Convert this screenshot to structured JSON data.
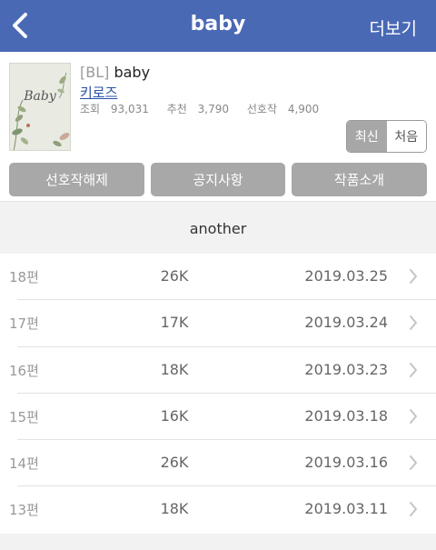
{
  "nav": {
    "back_icon": "chevron-left-icon",
    "title": "baby",
    "more_label": "더보기"
  },
  "book": {
    "cover_title": "Baby",
    "cover_subtitle": "",
    "genre": "[BL]",
    "title": "baby",
    "author": "키로즈",
    "stats": [
      {
        "label": "조회",
        "value": "93,031"
      },
      {
        "label": "추천",
        "value": "3,790"
      },
      {
        "label": "선호작",
        "value": "4,900"
      }
    ]
  },
  "sort": {
    "latest_label": "최신",
    "first_label": "처음",
    "active": "latest"
  },
  "actions": {
    "unfavorite_label": "선호작해제",
    "notice_label": "공지사항",
    "intro_label": "작품소개"
  },
  "section": {
    "title": "another"
  },
  "episodes": [
    {
      "ep": "18편",
      "size": "26K",
      "date": "2019.03.25"
    },
    {
      "ep": "17편",
      "size": "17K",
      "date": "2019.03.24"
    },
    {
      "ep": "16편",
      "size": "18K",
      "date": "2019.03.23"
    },
    {
      "ep": "15편",
      "size": "16K",
      "date": "2019.03.18"
    },
    {
      "ep": "14편",
      "size": "26K",
      "date": "2019.03.16"
    },
    {
      "ep": "13편",
      "size": "18K",
      "date": "2019.03.11"
    }
  ],
  "colors": {
    "nav_bg": "#4a69b5",
    "author_link": "#2b4fa5",
    "button_bg": "#a8a8a8"
  }
}
